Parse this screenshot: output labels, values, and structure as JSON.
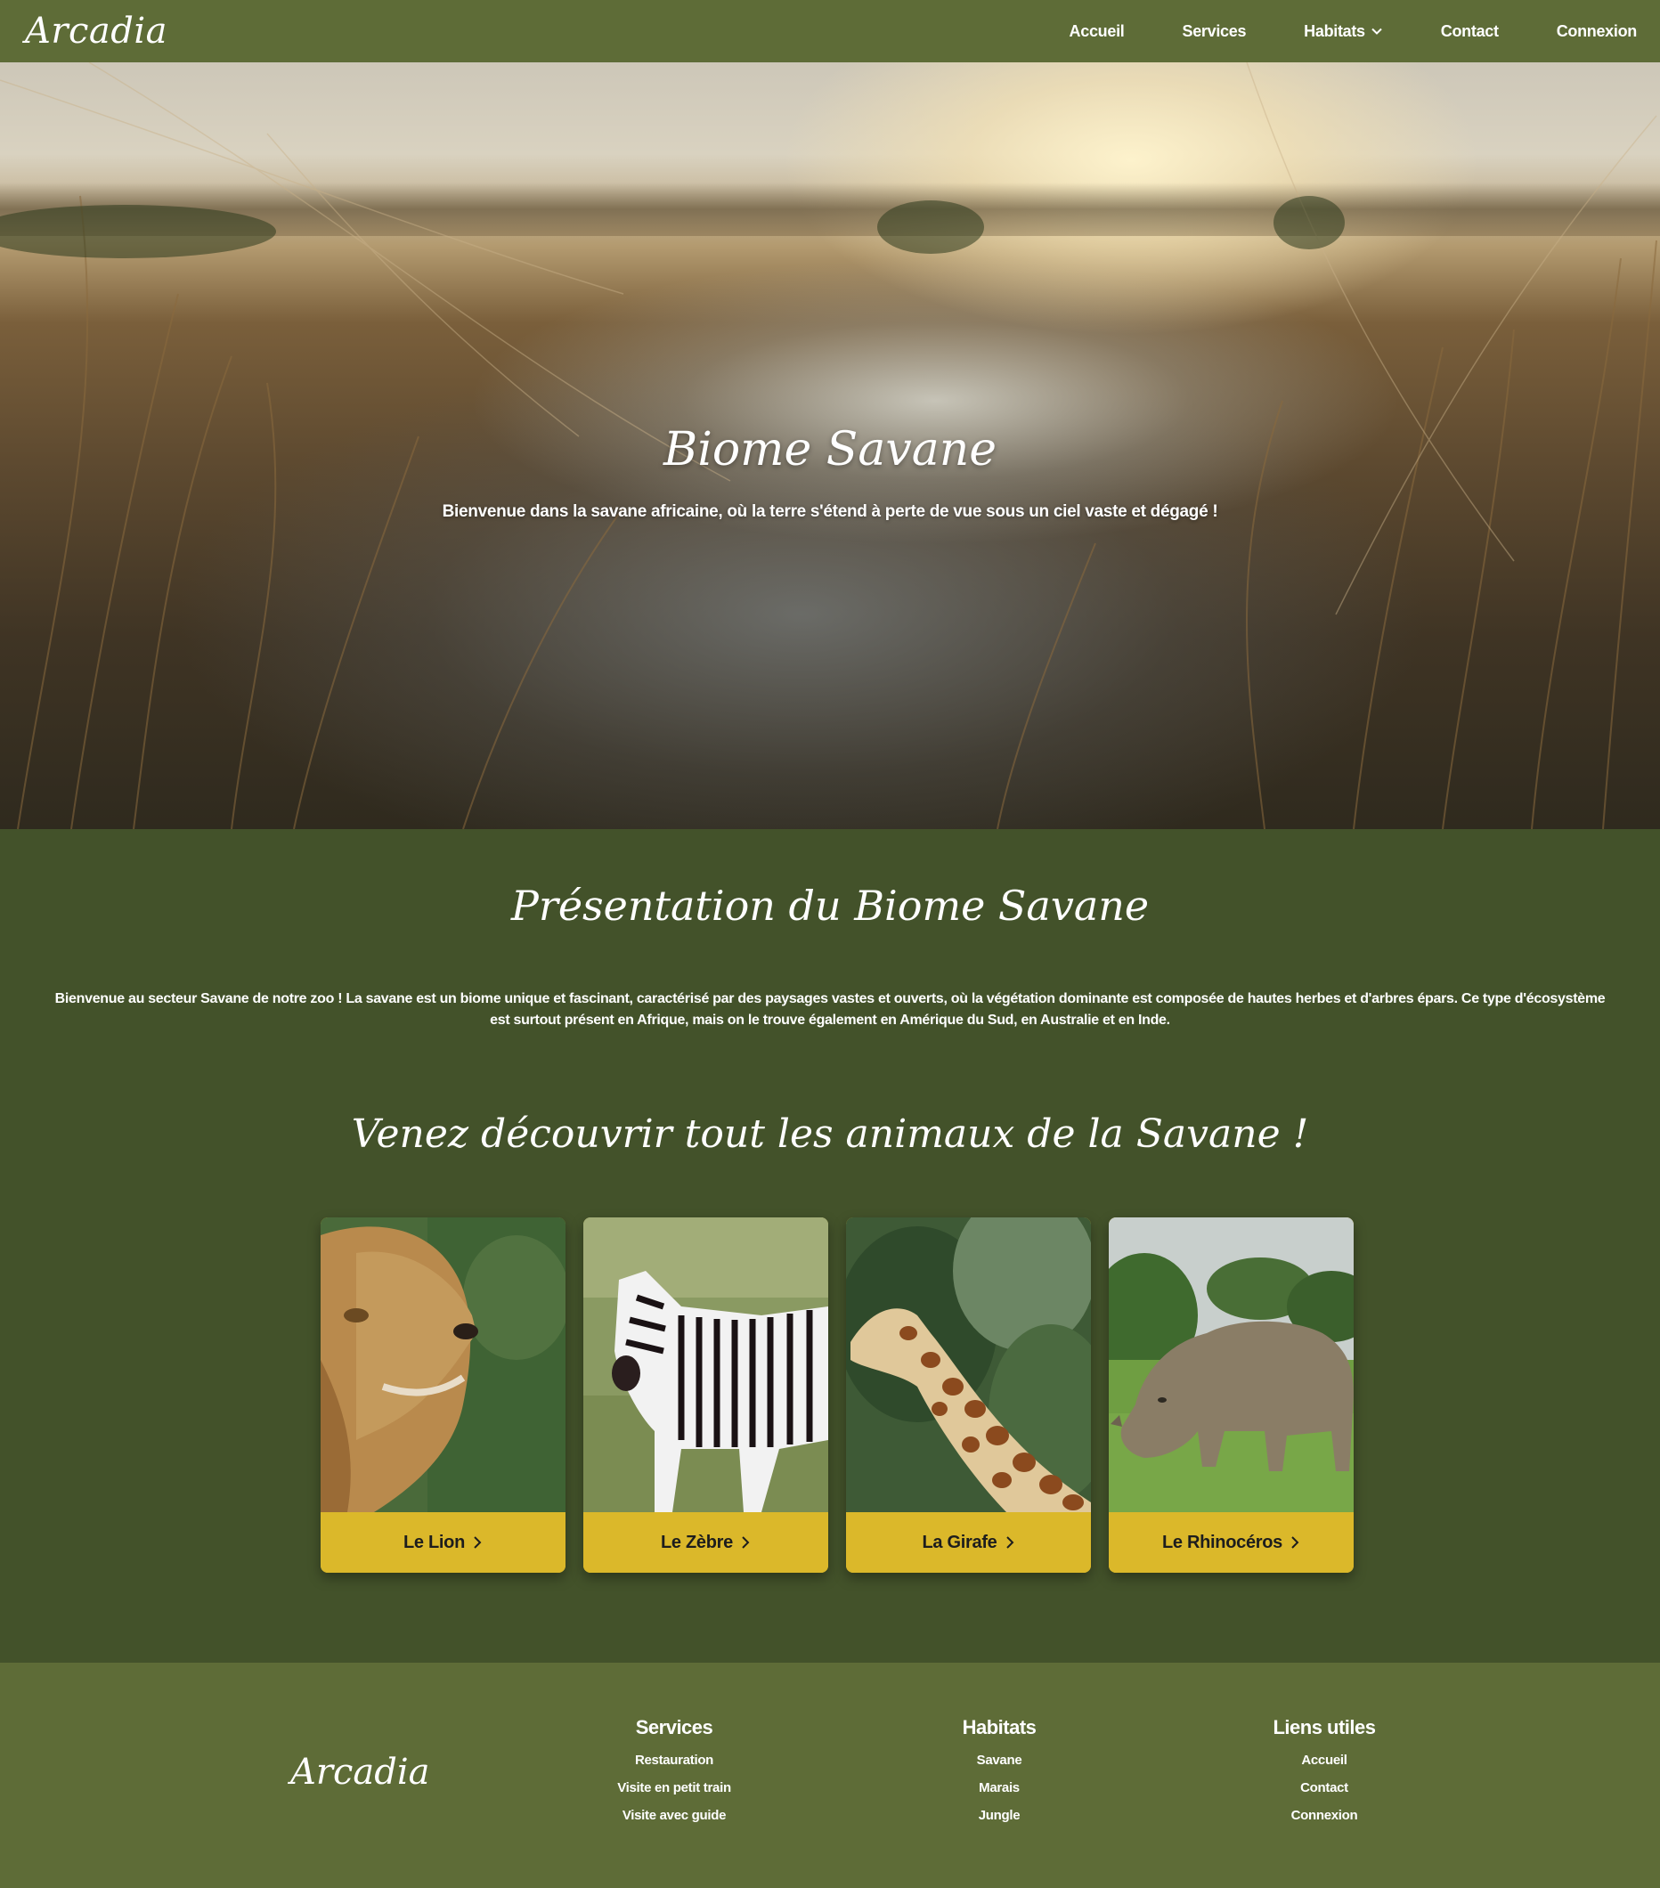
{
  "navbar": {
    "brand": "Arcadia",
    "items": [
      {
        "label": "Accueil"
      },
      {
        "label": "Services"
      },
      {
        "label": "Habitats"
      },
      {
        "label": "Contact"
      },
      {
        "label": "Connexion"
      }
    ]
  },
  "hero": {
    "title": "Biome Savane",
    "subtitle": "Bienvenue dans la savane africaine, où la terre s'étend à perte de vue sous un ciel vaste et dégagé !"
  },
  "presentation": {
    "title": "Présentation du Biome Savane",
    "text": "Bienvenue au secteur Savane de notre zoo ! La savane est un biome unique et fascinant, caractérisé par des paysages vastes et ouverts, où la végétation dominante est composée de hautes herbes et d'arbres épars. Ce type d'écosystème est surtout présent en Afrique, mais on le trouve également en Amérique du Sud, en Australie et en Inde."
  },
  "animals": {
    "title": "Venez découvrir tout les animaux de la Savane !",
    "cards": [
      {
        "label": "Le Lion",
        "icon": "lion-photo"
      },
      {
        "label": "Le Zèbre",
        "icon": "zebra-photo"
      },
      {
        "label": "La Girafe",
        "icon": "giraffe-photo"
      },
      {
        "label": "Le Rhinocéros",
        "icon": "rhino-photo"
      }
    ]
  },
  "footer": {
    "brand": "Arcadia",
    "columns": [
      {
        "title": "Services",
        "links": [
          "Restauration",
          "Visite en petit train",
          "Visite avec guide"
        ]
      },
      {
        "title": "Habitats",
        "links": [
          "Savane",
          "Marais",
          "Jungle"
        ]
      },
      {
        "title": "Liens utiles",
        "links": [
          "Accueil",
          "Contact",
          "Connexion"
        ]
      }
    ]
  },
  "colors": {
    "nav_bg": "#5e6c37",
    "page_bg": "#43522a",
    "button_yellow": "#dbb82a"
  }
}
